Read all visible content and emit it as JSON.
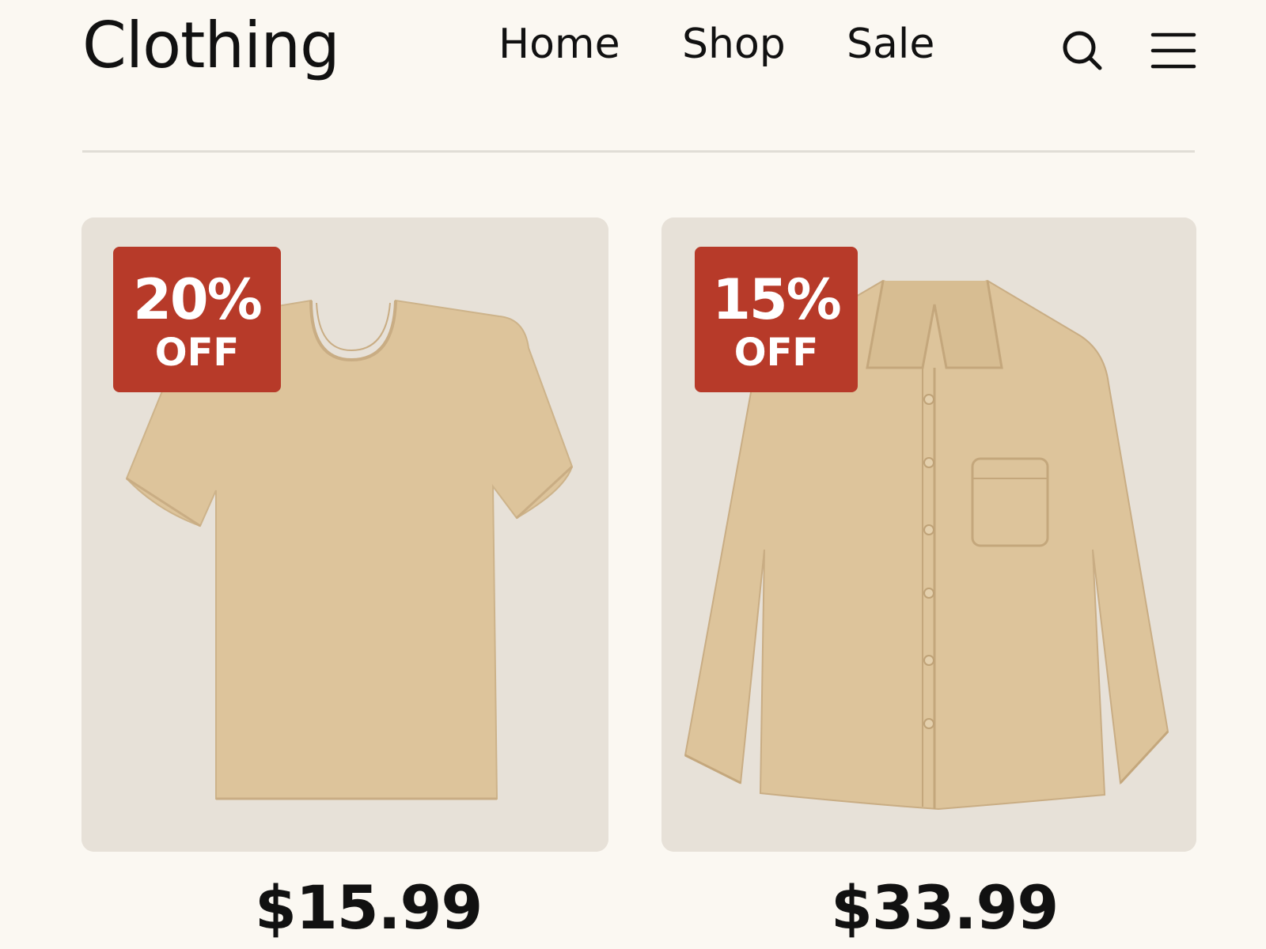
{
  "header": {
    "brand": "Clothing",
    "nav": [
      "Home",
      "Shop",
      "Sale"
    ],
    "search_icon": "search-icon",
    "menu_icon": "menu-icon"
  },
  "products": [
    {
      "name": "t-shirt",
      "discount_percent": "20%",
      "discount_label": "OFF",
      "price": "$15.99",
      "image_icon": "tshirt-image"
    },
    {
      "name": "button-up shirt",
      "discount_percent": "15%",
      "discount_label": "OFF",
      "price": "$33.99",
      "image_icon": "shirt-image"
    }
  ],
  "colors": {
    "background": "#fbf8f2",
    "card": "#e7e1d8",
    "badge": "#b73a29",
    "garment": "#ddc49b",
    "text": "#111111"
  }
}
